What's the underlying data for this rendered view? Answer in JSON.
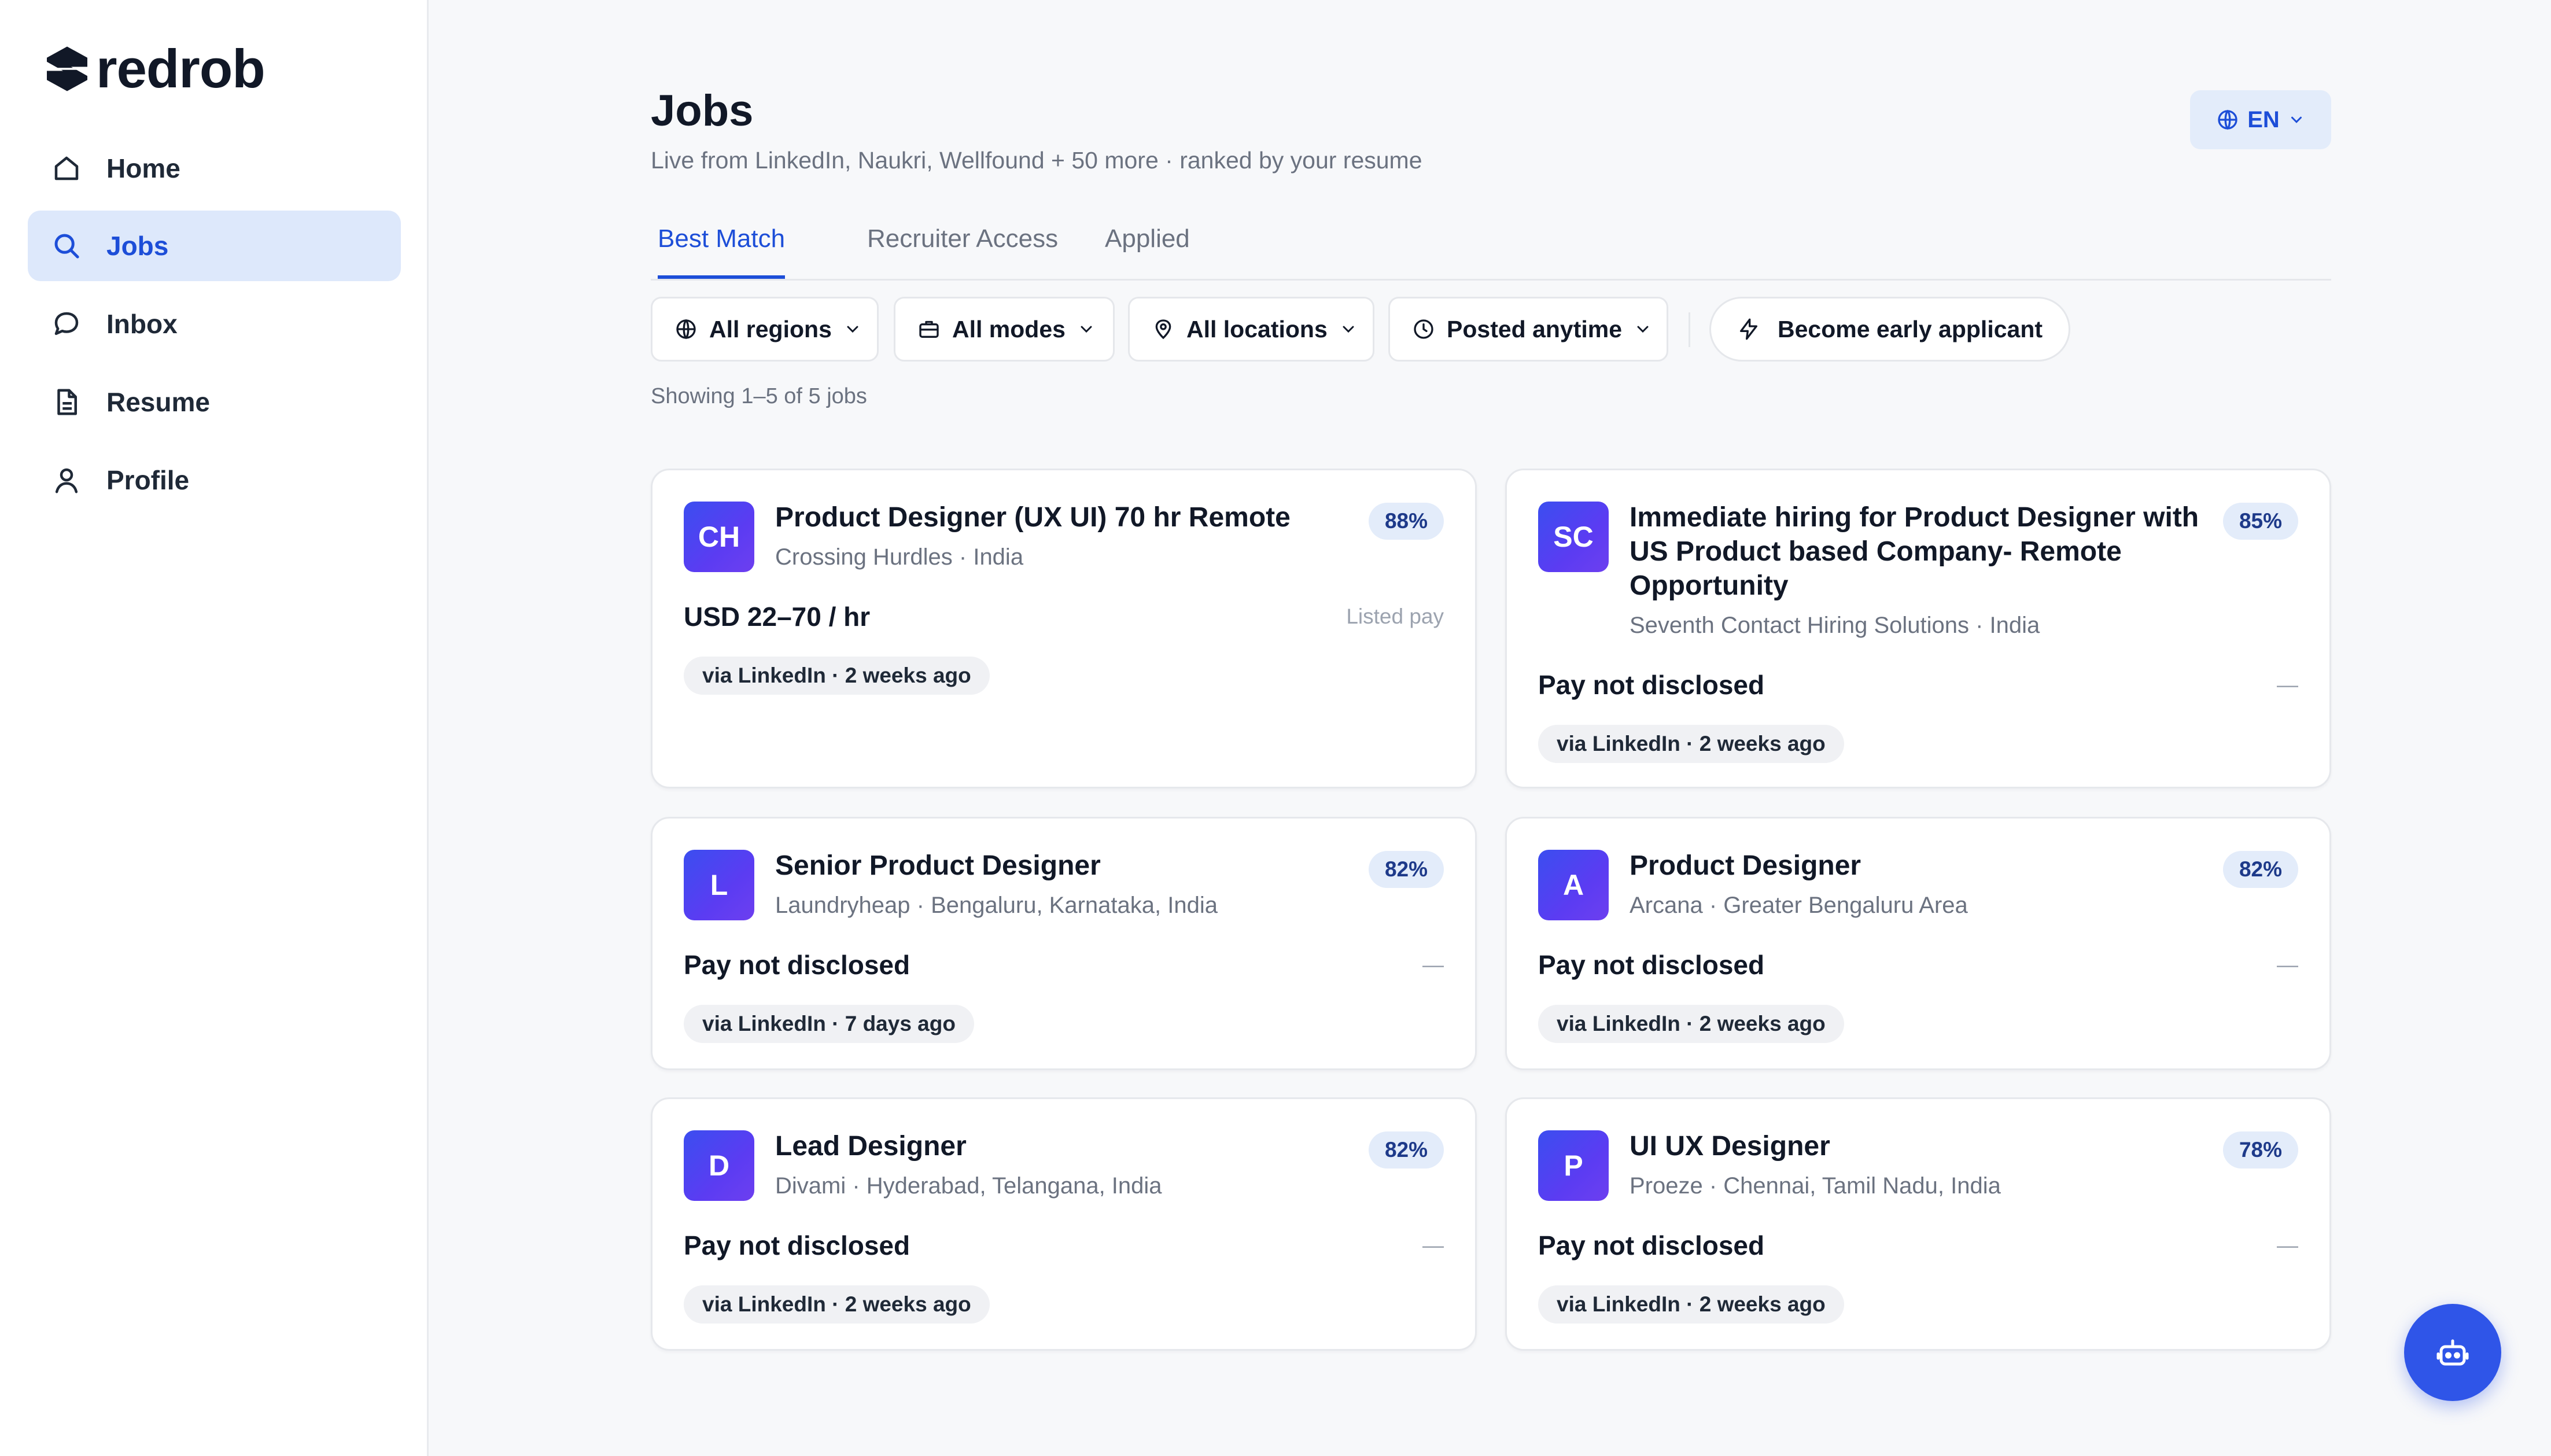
{
  "app": {
    "logo_text": "redrob"
  },
  "sidebar": {
    "items": [
      {
        "label": "Home",
        "icon": "home-icon"
      },
      {
        "label": "Jobs",
        "icon": "search-icon",
        "active": true
      },
      {
        "label": "Inbox",
        "icon": "chat-icon"
      },
      {
        "label": "Resume",
        "icon": "document-icon"
      },
      {
        "label": "Profile",
        "icon": "user-icon"
      }
    ]
  },
  "header": {
    "title": "Jobs",
    "subtitle": "Live from LinkedIn, Naukri, Wellfound + 50 more · ranked by your resume",
    "language": "EN"
  },
  "tabs": [
    {
      "label": "Best Match",
      "active": true
    },
    {
      "label": "Recruiter Access"
    },
    {
      "label": "Applied"
    }
  ],
  "filters": {
    "regions": "All regions",
    "modes": "All modes",
    "locations": "All locations",
    "posted": "Posted anytime",
    "early_applicant": "Become early applicant"
  },
  "results_text": "Showing 1–5 of 5 jobs",
  "jobs": [
    {
      "initials": "CH",
      "title": "Product Designer (UX UI) 70 hr Remote",
      "meta": "Crossing Hurdles · India",
      "match": "88%",
      "pay": "USD 22–70 / hr",
      "pay_note": "Listed pay",
      "source": "via LinkedIn · 2 weeks ago"
    },
    {
      "initials": "SC",
      "title": "Immediate hiring for Product Designer with US Product based Company- Remote Opportunity",
      "meta": "Seventh Contact Hiring Solutions · India",
      "match": "85%",
      "pay": "Pay not disclosed",
      "pay_note": "—",
      "source": "via LinkedIn · 2 weeks ago"
    },
    {
      "initials": "L",
      "title": "Senior Product Designer",
      "meta": "Laundryheap · Bengaluru, Karnataka, India",
      "match": "82%",
      "pay": "Pay not disclosed",
      "pay_note": "—",
      "source": "via LinkedIn · 7 days ago"
    },
    {
      "initials": "A",
      "title": "Product Designer",
      "meta": "Arcana · Greater Bengaluru Area",
      "match": "82%",
      "pay": "Pay not disclosed",
      "pay_note": "—",
      "source": "via LinkedIn · 2 weeks ago"
    },
    {
      "initials": "D",
      "title": "Lead Designer",
      "meta": "Divami · Hyderabad, Telangana, India",
      "match": "82%",
      "pay": "Pay not disclosed",
      "pay_note": "—",
      "source": "via LinkedIn · 2 weeks ago"
    },
    {
      "initials": "P",
      "title": "UI UX Designer",
      "meta": "Proeze · Chennai, Tamil Nadu, India",
      "match": "78%",
      "pay": "Pay not disclosed",
      "pay_note": "—",
      "source": "via LinkedIn · 2 weeks ago"
    }
  ],
  "colors": {
    "accent": "#1d4ed8",
    "active_nav_bg": "#dde8fb",
    "badge_bg": "#e3ecfa",
    "avatar_gradient_start": "#3b4ef0",
    "avatar_gradient_end": "#6d3ff0",
    "assistant_button": "#2f55e8"
  },
  "assistant_icon": "robot-icon"
}
